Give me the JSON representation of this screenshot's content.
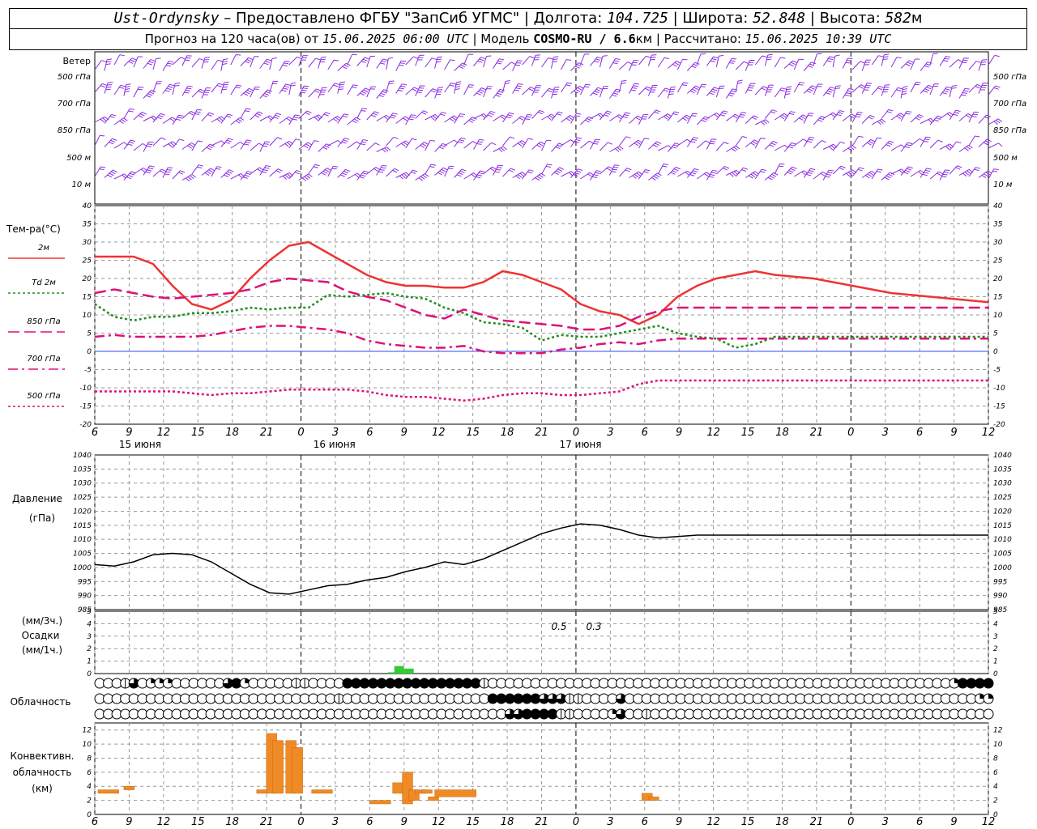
{
  "header": {
    "station": "Ust-Ordynsky",
    "sep1": " – Предоставлено ФГБУ \"ЗапСиб УГМС\" | ",
    "lon_label": "Долгота: ",
    "lon": "104.725",
    "lat_label": " | Широта: ",
    "lat": "52.848",
    "alt_label": " | Высота: ",
    "alt": "582",
    "alt_unit": "м",
    "forecast_label": "Прогноз на 120 часа(ов) от ",
    "forecast_from": "15.06.2025 06:00 UTC",
    "model_label": " | Модель ",
    "model": "COSMO-RU / 6.6",
    "model_unit": "км",
    "calc_label": " | Рассчитано: ",
    "calc_time": "15.06.2025 10:39 UTC"
  },
  "time_axis": {
    "tick_labels": [
      "6",
      "9",
      "12",
      "15",
      "18",
      "21",
      "0",
      "3",
      "6",
      "9",
      "12",
      "15",
      "18",
      "21",
      "0",
      "3",
      "6",
      "9",
      "12",
      "15",
      "18",
      "21",
      "0",
      "3",
      "6",
      "9",
      "12"
    ],
    "day_labels": [
      "15 июня",
      "16 июня",
      "17 июня"
    ]
  },
  "wind_panel": {
    "title": "Ветер",
    "levels": [
      "500 гПа",
      "700 гПа",
      "850 гПа",
      "500 м",
      "10 м"
    ],
    "color": "#8a2be2"
  },
  "chart_data": [
    {
      "type": "line",
      "title": "Тем-ра(°С)",
      "x_hours": [
        6,
        9,
        12,
        15,
        18,
        21,
        24,
        27,
        30,
        33,
        36,
        39,
        42,
        45,
        48,
        51,
        54,
        57,
        60,
        63,
        66,
        69,
        72,
        75,
        78,
        81,
        84,
        87,
        90,
        93,
        96,
        99,
        102,
        105,
        108,
        111,
        114,
        117,
        120,
        123,
        126,
        129,
        132,
        135,
        138,
        141,
        144
      ],
      "ylim": [
        -20,
        40
      ],
      "yticks": [
        -20,
        -15,
        -10,
        -5,
        0,
        5,
        10,
        15,
        20,
        25,
        30,
        35,
        40
      ],
      "series": [
        {
          "name": "2м",
          "color": "#ee3333",
          "style": "solid",
          "values": [
            26,
            26,
            26,
            24,
            18,
            13,
            11.5,
            14,
            20,
            25,
            29,
            30,
            27,
            24,
            21,
            19,
            18,
            18,
            17.5,
            17.5,
            19,
            22,
            21,
            19,
            17,
            13,
            11,
            10,
            7.5,
            10,
            15,
            18,
            20,
            21,
            22,
            21,
            20.5,
            20,
            19,
            18,
            17,
            16,
            15.5,
            15,
            14.5,
            14,
            13.5
          ]
        },
        {
          "name": "Td 2м",
          "color": "#228b22",
          "style": "dotted",
          "values": [
            13,
            9.5,
            8.5,
            9.5,
            9.5,
            10.5,
            10.5,
            11,
            12,
            11.5,
            12,
            12,
            15.5,
            15,
            15.5,
            16,
            15,
            14.5,
            12,
            10.5,
            8,
            7.5,
            6.5,
            3,
            4.5,
            4,
            4,
            5,
            6,
            7,
            5,
            4,
            3.5,
            1,
            2,
            4,
            4,
            4,
            4,
            4,
            4,
            4,
            4,
            4,
            4,
            4,
            4
          ]
        },
        {
          "name": "850 гПа",
          "color": "#dd1177",
          "style": "dashed",
          "values": [
            16,
            17,
            16,
            15,
            14.5,
            15,
            15.5,
            16,
            17,
            19,
            20,
            19.5,
            19,
            16.5,
            15,
            14,
            12,
            10,
            9,
            11.5,
            10,
            8.5,
            8,
            7.5,
            7,
            6,
            6,
            7,
            9.5,
            11,
            12,
            12,
            12,
            12,
            12,
            12,
            12,
            12,
            12,
            12,
            12,
            12,
            12,
            12,
            12,
            12,
            12
          ]
        },
        {
          "name": "700 гПа",
          "color": "#dd1177",
          "style": "dashdot",
          "values": [
            4,
            4.5,
            4,
            4,
            4,
            4,
            4.5,
            5.5,
            6.5,
            7,
            7,
            6.5,
            6,
            5,
            3,
            2,
            1.5,
            1,
            1,
            1.5,
            0,
            -0.5,
            -0.5,
            -0.5,
            0.5,
            1,
            2,
            2.5,
            2,
            3,
            3.5,
            3.5,
            3.5,
            3.5,
            3.5,
            3.5,
            3.5,
            3.5,
            3.5,
            3.5,
            3.5,
            3.5,
            3.5,
            3.5,
            3.5,
            3.5,
            3.5
          ]
        },
        {
          "name": "500 гПа",
          "color": "#dd1177",
          "style": "dotted",
          "values": [
            -11,
            -11,
            -11,
            -11,
            -11,
            -11.5,
            -12,
            -11.5,
            -11.5,
            -11,
            -10.5,
            -10.5,
            -10.5,
            -10.5,
            -11,
            -12,
            -12.5,
            -12.5,
            -13,
            -13.5,
            -13,
            -12,
            -11.5,
            -11.5,
            -12,
            -12,
            -11.5,
            -11,
            -9,
            -8,
            -8,
            -8,
            -8,
            -8,
            -8,
            -8,
            -8,
            -8,
            -8,
            -8,
            -8,
            -8,
            -8,
            -8,
            -8,
            -8,
            -8
          ]
        }
      ]
    },
    {
      "type": "line",
      "title": "Давление",
      "ylabel": "(гПа)",
      "x_hours": [
        6,
        9,
        12,
        15,
        18,
        21,
        24,
        27,
        30,
        33,
        36,
        39,
        42,
        45,
        48,
        51,
        54,
        57,
        60,
        63,
        66,
        69,
        72,
        75,
        78,
        81,
        84,
        87,
        90,
        93,
        96,
        99,
        102,
        105,
        108,
        111,
        114,
        117,
        120,
        123,
        126,
        129,
        132,
        135,
        138,
        141,
        144
      ],
      "ylim": [
        985,
        1040
      ],
      "yticks": [
        985,
        990,
        995,
        1000,
        1005,
        1010,
        1015,
        1020,
        1025,
        1030,
        1035,
        1040
      ],
      "series": [
        {
          "name": "",
          "color": "#000000",
          "values": [
            1001,
            1000.5,
            1002,
            1004.5,
            1005,
            1004.5,
            1002,
            998,
            994,
            991,
            990.5,
            992,
            993.5,
            994,
            995.5,
            996.5,
            998.5,
            1000,
            1002,
            1001,
            1003,
            1006,
            1009,
            1012,
            1014,
            1015.5,
            1015,
            1013.5,
            1011.5,
            1010.5,
            1011,
            1011.5,
            1011.5,
            1011.5,
            1011.5,
            1011.5,
            1011.5,
            1011.5,
            1011.5,
            1011.5,
            1011.5,
            1011.5,
            1011.5,
            1011.5,
            1011.5,
            1011.5,
            1011.5
          ]
        }
      ]
    },
    {
      "type": "bar",
      "title": "Осадки",
      "ylabel_top": "(мм/3ч.)",
      "ylabel_bottom": "(мм/1ч.)",
      "ylim": [
        0,
        5
      ],
      "yticks": [
        0,
        1,
        2,
        3,
        4,
        5
      ],
      "annotations": [
        "0.5",
        "0.3"
      ],
      "bars": [
        {
          "x_hour": 53,
          "value": 0.6
        },
        {
          "x_hour": 54.5,
          "value": 0.4
        },
        {
          "x_hour": 52,
          "value": 0.1
        }
      ]
    },
    {
      "type": "bar",
      "title": "Конвективн.",
      "title2": "облачность",
      "ylabel": "(км)",
      "ylim": [
        0,
        13
      ],
      "yticks": [
        0,
        2,
        4,
        6,
        8,
        10,
        12
      ],
      "segments": [
        {
          "x_hour": 7.5,
          "w": 2,
          "base": 3,
          "top": 3.5
        },
        {
          "x_hour": 11,
          "w": 1,
          "base": 3.5,
          "top": 4
        },
        {
          "x_hour": 31.5,
          "w": 1,
          "base": 3,
          "top": 3.5
        },
        {
          "x_hour": 33,
          "w": 1,
          "base": 3,
          "top": 11.5
        },
        {
          "x_hour": 34,
          "w": 1,
          "base": 3,
          "top": 10.5
        },
        {
          "x_hour": 36,
          "w": 1,
          "base": 3,
          "top": 10.5
        },
        {
          "x_hour": 37,
          "w": 1,
          "base": 3,
          "top": 9.5
        },
        {
          "x_hour": 40.5,
          "w": 2,
          "base": 3,
          "top": 3.5
        },
        {
          "x_hour": 49.5,
          "w": 2,
          "base": 1.5,
          "top": 2
        },
        {
          "x_hour": 52.5,
          "w": 1,
          "base": 3,
          "top": 4.5
        },
        {
          "x_hour": 54,
          "w": 1,
          "base": 1.5,
          "top": 6
        },
        {
          "x_hour": 55,
          "w": 1,
          "base": 2,
          "top": 3.5
        },
        {
          "x_hour": 56,
          "w": 1,
          "base": 3,
          "top": 3.5
        },
        {
          "x_hour": 57,
          "w": 1,
          "base": 3,
          "top": 3.5
        },
        {
          "x_hour": 58,
          "w": 1,
          "base": 2,
          "top": 2.5
        },
        {
          "x_hour": 60.5,
          "w": 4,
          "base": 2.5,
          "top": 3.5
        },
        {
          "x_hour": 91,
          "w": 1,
          "base": 2,
          "top": 3
        },
        {
          "x_hour": 92,
          "w": 1,
          "base": 2,
          "top": 2.5
        }
      ]
    }
  ],
  "cloud_panel": {
    "title": "Облачность",
    "rows": [
      "000130222000000342000001100004444444444444444100000000000000000000000000000000000000000000000000000024444",
      "000000000000000000000000000010000000000000000044444433311000030000000000000000000000000000000000000000022",
      "000000000000000000000000000000000000000000000000334444110000230010000000000000000000000000000000000000000"
    ]
  }
}
